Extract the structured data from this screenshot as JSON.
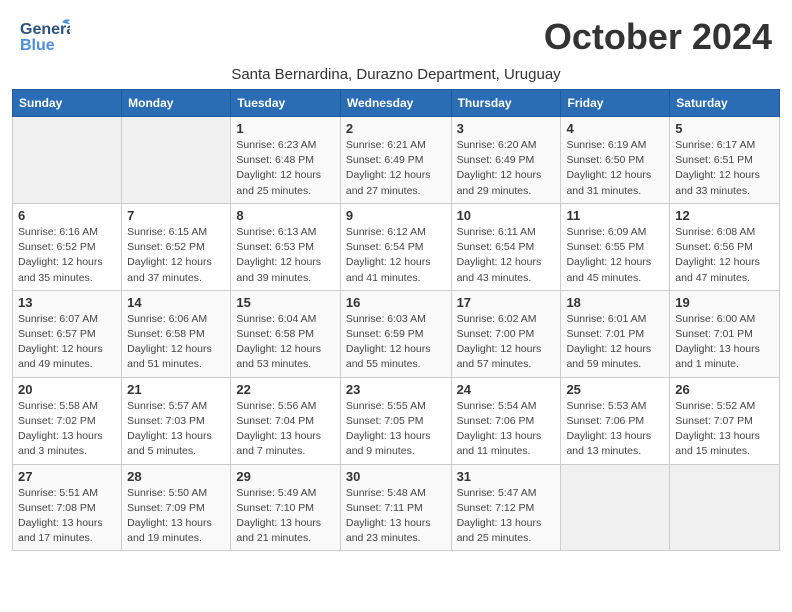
{
  "header": {
    "logo_general": "General",
    "logo_blue": "Blue",
    "month_title": "October 2024",
    "subtitle": "Santa Bernardina, Durazno Department, Uruguay"
  },
  "calendar": {
    "day_headers": [
      "Sunday",
      "Monday",
      "Tuesday",
      "Wednesday",
      "Thursday",
      "Friday",
      "Saturday"
    ],
    "weeks": [
      [
        {
          "day": "",
          "info": ""
        },
        {
          "day": "",
          "info": ""
        },
        {
          "day": "1",
          "info": "Sunrise: 6:23 AM\nSunset: 6:48 PM\nDaylight: 12 hours\nand 25 minutes."
        },
        {
          "day": "2",
          "info": "Sunrise: 6:21 AM\nSunset: 6:49 PM\nDaylight: 12 hours\nand 27 minutes."
        },
        {
          "day": "3",
          "info": "Sunrise: 6:20 AM\nSunset: 6:49 PM\nDaylight: 12 hours\nand 29 minutes."
        },
        {
          "day": "4",
          "info": "Sunrise: 6:19 AM\nSunset: 6:50 PM\nDaylight: 12 hours\nand 31 minutes."
        },
        {
          "day": "5",
          "info": "Sunrise: 6:17 AM\nSunset: 6:51 PM\nDaylight: 12 hours\nand 33 minutes."
        }
      ],
      [
        {
          "day": "6",
          "info": "Sunrise: 6:16 AM\nSunset: 6:52 PM\nDaylight: 12 hours\nand 35 minutes."
        },
        {
          "day": "7",
          "info": "Sunrise: 6:15 AM\nSunset: 6:52 PM\nDaylight: 12 hours\nand 37 minutes."
        },
        {
          "day": "8",
          "info": "Sunrise: 6:13 AM\nSunset: 6:53 PM\nDaylight: 12 hours\nand 39 minutes."
        },
        {
          "day": "9",
          "info": "Sunrise: 6:12 AM\nSunset: 6:54 PM\nDaylight: 12 hours\nand 41 minutes."
        },
        {
          "day": "10",
          "info": "Sunrise: 6:11 AM\nSunset: 6:54 PM\nDaylight: 12 hours\nand 43 minutes."
        },
        {
          "day": "11",
          "info": "Sunrise: 6:09 AM\nSunset: 6:55 PM\nDaylight: 12 hours\nand 45 minutes."
        },
        {
          "day": "12",
          "info": "Sunrise: 6:08 AM\nSunset: 6:56 PM\nDaylight: 12 hours\nand 47 minutes."
        }
      ],
      [
        {
          "day": "13",
          "info": "Sunrise: 6:07 AM\nSunset: 6:57 PM\nDaylight: 12 hours\nand 49 minutes."
        },
        {
          "day": "14",
          "info": "Sunrise: 6:06 AM\nSunset: 6:58 PM\nDaylight: 12 hours\nand 51 minutes."
        },
        {
          "day": "15",
          "info": "Sunrise: 6:04 AM\nSunset: 6:58 PM\nDaylight: 12 hours\nand 53 minutes."
        },
        {
          "day": "16",
          "info": "Sunrise: 6:03 AM\nSunset: 6:59 PM\nDaylight: 12 hours\nand 55 minutes."
        },
        {
          "day": "17",
          "info": "Sunrise: 6:02 AM\nSunset: 7:00 PM\nDaylight: 12 hours\nand 57 minutes."
        },
        {
          "day": "18",
          "info": "Sunrise: 6:01 AM\nSunset: 7:01 PM\nDaylight: 12 hours\nand 59 minutes."
        },
        {
          "day": "19",
          "info": "Sunrise: 6:00 AM\nSunset: 7:01 PM\nDaylight: 13 hours\nand 1 minute."
        }
      ],
      [
        {
          "day": "20",
          "info": "Sunrise: 5:58 AM\nSunset: 7:02 PM\nDaylight: 13 hours\nand 3 minutes."
        },
        {
          "day": "21",
          "info": "Sunrise: 5:57 AM\nSunset: 7:03 PM\nDaylight: 13 hours\nand 5 minutes."
        },
        {
          "day": "22",
          "info": "Sunrise: 5:56 AM\nSunset: 7:04 PM\nDaylight: 13 hours\nand 7 minutes."
        },
        {
          "day": "23",
          "info": "Sunrise: 5:55 AM\nSunset: 7:05 PM\nDaylight: 13 hours\nand 9 minutes."
        },
        {
          "day": "24",
          "info": "Sunrise: 5:54 AM\nSunset: 7:06 PM\nDaylight: 13 hours\nand 11 minutes."
        },
        {
          "day": "25",
          "info": "Sunrise: 5:53 AM\nSunset: 7:06 PM\nDaylight: 13 hours\nand 13 minutes."
        },
        {
          "day": "26",
          "info": "Sunrise: 5:52 AM\nSunset: 7:07 PM\nDaylight: 13 hours\nand 15 minutes."
        }
      ],
      [
        {
          "day": "27",
          "info": "Sunrise: 5:51 AM\nSunset: 7:08 PM\nDaylight: 13 hours\nand 17 minutes."
        },
        {
          "day": "28",
          "info": "Sunrise: 5:50 AM\nSunset: 7:09 PM\nDaylight: 13 hours\nand 19 minutes."
        },
        {
          "day": "29",
          "info": "Sunrise: 5:49 AM\nSunset: 7:10 PM\nDaylight: 13 hours\nand 21 minutes."
        },
        {
          "day": "30",
          "info": "Sunrise: 5:48 AM\nSunset: 7:11 PM\nDaylight: 13 hours\nand 23 minutes."
        },
        {
          "day": "31",
          "info": "Sunrise: 5:47 AM\nSunset: 7:12 PM\nDaylight: 13 hours\nand 25 minutes."
        },
        {
          "day": "",
          "info": ""
        },
        {
          "day": "",
          "info": ""
        }
      ]
    ]
  }
}
